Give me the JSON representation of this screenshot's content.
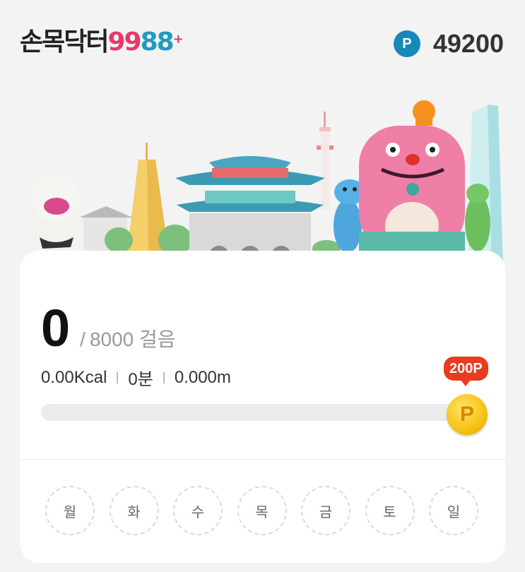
{
  "header": {
    "logo_ko": "손목닥터",
    "logo_n1": "9",
    "logo_n2": "9",
    "logo_n3": "8",
    "logo_n4": "8",
    "logo_plus": "+",
    "points_badge": "P",
    "points_value": "49200"
  },
  "steps": {
    "count": "0",
    "slash": "/",
    "goal": "8000 걸음"
  },
  "stats": {
    "kcal": "0.00Kcal",
    "minutes": "0분",
    "distance": "0.000m"
  },
  "reward": {
    "bubble": "200P",
    "coin_label": "P",
    "progress_fraction": 0
  },
  "days": [
    "월",
    "화",
    "수",
    "목",
    "금",
    "토",
    "일"
  ],
  "colors": {
    "brand_pink": "#e8386d",
    "brand_blue": "#1789b8",
    "reward_red": "#ea3a20",
    "coin_gold": "#f7c51a"
  }
}
